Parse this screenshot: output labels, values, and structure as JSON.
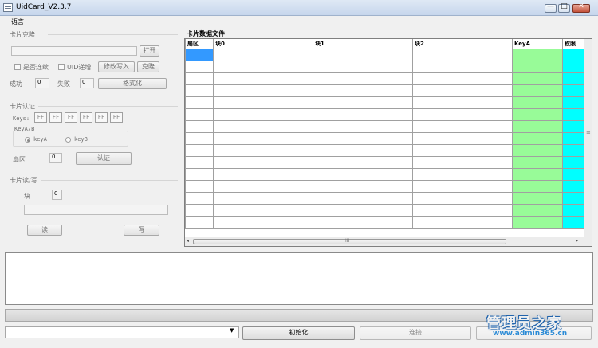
{
  "window": {
    "title": "UidCard_V2.3.7",
    "min_glyph": "—",
    "max_glyph": "□",
    "close_glyph": "✕"
  },
  "menu": {
    "language": "语言"
  },
  "clone": {
    "header": "卡片克隆",
    "open_label": "打开",
    "continuous_label": "是否连续",
    "uid_incr_label": "UID递增",
    "modify_write_label": "修改写入",
    "clone_label": "克隆",
    "success_label": "成功",
    "success_value": "0",
    "fail_label": "失败",
    "fail_value": "0",
    "format_label": "格式化"
  },
  "auth": {
    "header": "卡片认证",
    "keys_label": "Keys:",
    "keys": [
      "FF",
      "FF",
      "FF",
      "FF",
      "FF",
      "FF"
    ],
    "keyab_label": "KeyA/B",
    "keya_label": "keyA",
    "keyb_label": "keyB",
    "sector_label": "扇区",
    "sector_value": "0",
    "auth_button": "认证"
  },
  "rw": {
    "header": "卡片读/写",
    "block_label": "块",
    "block_value": "0",
    "read_label": "读",
    "write_label": "写"
  },
  "data": {
    "header": "卡片数据文件",
    "columns": [
      "扇区",
      "块0",
      "块1",
      "块2",
      "KeyA",
      "权限"
    ],
    "row_count": 15,
    "hscroll_thumb": "III"
  },
  "bottom": {
    "init_label": "初始化",
    "connect_label": "连接"
  },
  "watermark": {
    "line1": "管理员之家",
    "line2": "www.admin365.cn"
  },
  "colors": {
    "keya": "#98fb98",
    "perm": "#00ffff",
    "selected": "#3399ff"
  }
}
